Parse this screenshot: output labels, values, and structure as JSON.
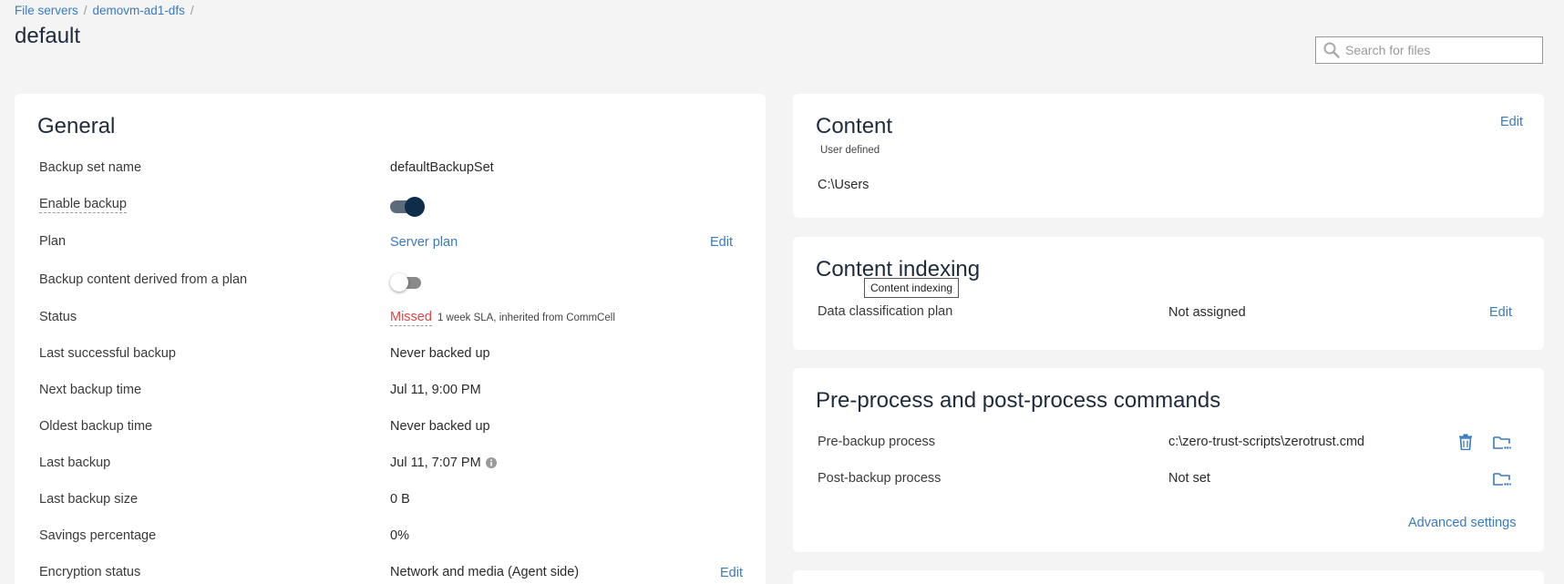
{
  "breadcrumb": {
    "items": [
      "File servers",
      "demovm-ad1-dfs"
    ],
    "separator": "/"
  },
  "page": {
    "title": "default"
  },
  "search": {
    "placeholder": "Search for files",
    "value": ""
  },
  "general": {
    "title": "General",
    "rows": {
      "backup_set_name": {
        "label": "Backup set name",
        "value": "defaultBackupSet"
      },
      "enable_backup": {
        "label": "Enable backup",
        "enabled": true
      },
      "plan": {
        "label": "Plan",
        "value": "Server plan",
        "action": "Edit"
      },
      "derived": {
        "label": "Backup content derived from a plan",
        "enabled": false
      },
      "status": {
        "label": "Status",
        "value": "Missed",
        "note": "1 week SLA, inherited from CommCell"
      },
      "last_successful": {
        "label": "Last successful backup",
        "value": "Never backed up"
      },
      "next_backup": {
        "label": "Next backup time",
        "value": "Jul 11, 9:00 PM"
      },
      "oldest_backup": {
        "label": "Oldest backup time",
        "value": "Never backed up"
      },
      "last_backup": {
        "label": "Last backup",
        "value": "Jul 11, 7:07 PM"
      },
      "last_backup_size": {
        "label": "Last backup size",
        "value": "0 B"
      },
      "savings": {
        "label": "Savings percentage",
        "value": "0%"
      },
      "encryption": {
        "label": "Encryption status",
        "value": "Network and media (Agent side)",
        "action": "Edit"
      }
    }
  },
  "content": {
    "title": "Content",
    "subtitle": "User defined",
    "path": "C:\\Users",
    "action": "Edit"
  },
  "content_indexing": {
    "title": "Content indexing",
    "tooltip": "Content indexing",
    "row": {
      "label": "Data classification plan",
      "value": "Not assigned",
      "action": "Edit"
    }
  },
  "commands": {
    "title": "Pre-process and post-process commands",
    "pre": {
      "label": "Pre-backup process",
      "value": "c:\\zero-trust-scripts\\zerotrust.cmd"
    },
    "post": {
      "label": "Post-backup process",
      "value": "Not set"
    },
    "advanced": "Advanced settings"
  },
  "colors": {
    "accent": "#3a7abf",
    "missed": "#e04646",
    "toggle_on": "#0d2d4a"
  }
}
